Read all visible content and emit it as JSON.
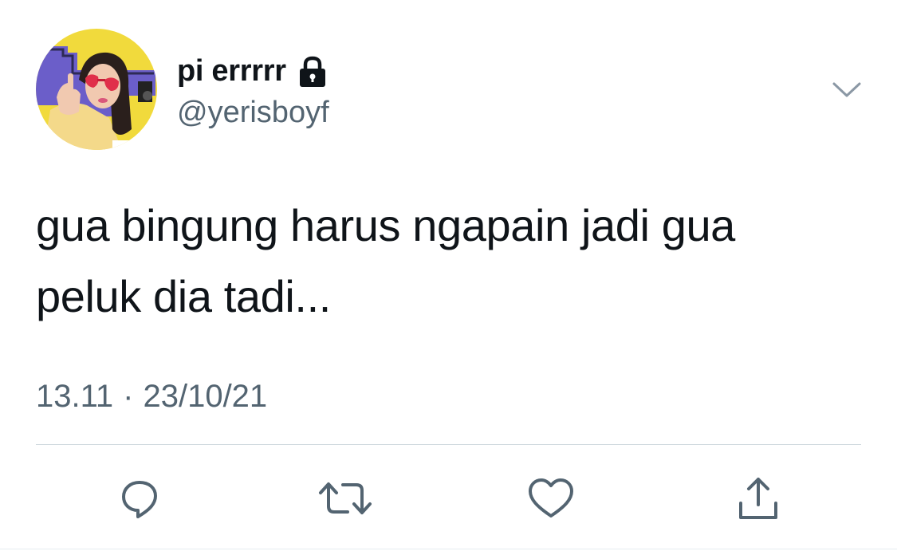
{
  "tweet": {
    "display_name": "pi errrrr",
    "username": "@yerisboyf",
    "text_line1": "gua bingung harus ngapain jadi gua",
    "text_line2": "peluk dia tadi...",
    "time": "13.11",
    "separator": "·",
    "date": "23/10/21",
    "protected": true
  },
  "icons": {
    "lock": "lock-icon",
    "caret": "chevron-down-icon",
    "reply": "reply-icon",
    "retweet": "retweet-icon",
    "like": "heart-icon",
    "share": "share-icon"
  },
  "colors": {
    "text_primary": "#0f1419",
    "text_secondary": "#536471",
    "icon_gray": "#536471",
    "divider": "#cfd9de",
    "avatar_background": "#f2dc3f",
    "avatar_accent": "#6a5fc4"
  }
}
